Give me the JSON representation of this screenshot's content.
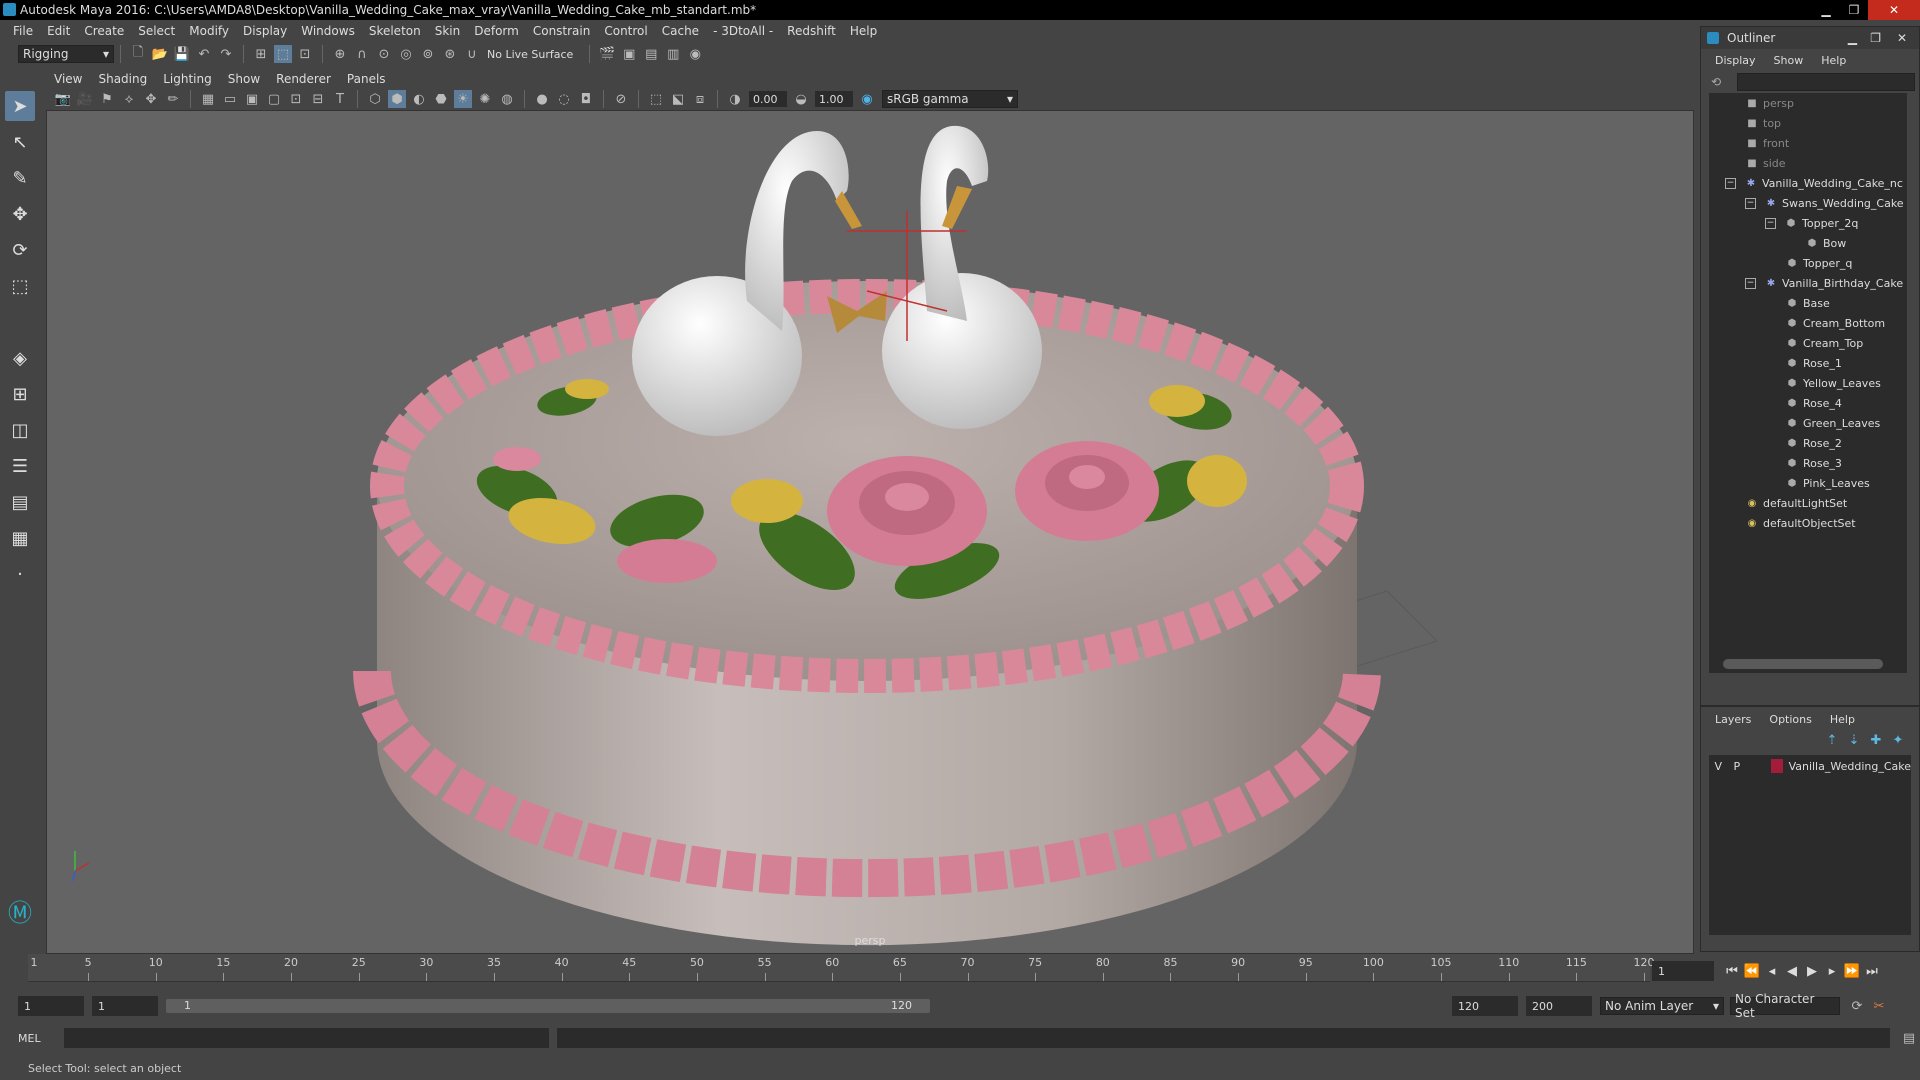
{
  "window": {
    "title": "Autodesk Maya 2016: C:\\Users\\AMDA8\\Desktop\\Vanilla_Wedding_Cake_max_vray\\Vanilla_Wedding_Cake_mb_standart.mb*"
  },
  "menus": [
    "File",
    "Edit",
    "Create",
    "Select",
    "Modify",
    "Display",
    "Windows",
    "Skeleton",
    "Skin",
    "Deform",
    "Constrain",
    "Control",
    "Cache",
    "- 3DtoAll -",
    "Redshift",
    "Help"
  ],
  "shelf": {
    "mode": "Rigging",
    "live_surface": "No Live Surface"
  },
  "panel_menus": [
    "View",
    "Shading",
    "Lighting",
    "Show",
    "Renderer",
    "Panels"
  ],
  "viewport_tools": {
    "exposure": "0.00",
    "gamma": "1.00",
    "colorspace": "sRGB gamma"
  },
  "viewport": {
    "camera_label": "persp"
  },
  "outliner": {
    "title": "Outliner",
    "menus": [
      "Display",
      "Show",
      "Help"
    ],
    "items": [
      {
        "label": "persp",
        "dim": true
      },
      {
        "label": "top",
        "dim": true
      },
      {
        "label": "front",
        "dim": true
      },
      {
        "label": "side",
        "dim": true
      },
      {
        "label": "Vanilla_Wedding_Cake_nc"
      },
      {
        "label": "Swans_Wedding_Cake"
      },
      {
        "label": "Topper_2q"
      },
      {
        "label": "Bow"
      },
      {
        "label": "Topper_q"
      },
      {
        "label": "Vanilla_Birthday_Cake"
      },
      {
        "label": "Base"
      },
      {
        "label": "Cream_Bottom"
      },
      {
        "label": "Cream_Top"
      },
      {
        "label": "Rose_1"
      },
      {
        "label": "Yellow_Leaves"
      },
      {
        "label": "Rose_4"
      },
      {
        "label": "Green_Leaves"
      },
      {
        "label": "Rose_2"
      },
      {
        "label": "Rose_3"
      },
      {
        "label": "Pink_Leaves"
      },
      {
        "label": "defaultLightSet"
      },
      {
        "label": "defaultObjectSet"
      }
    ]
  },
  "layers": {
    "menus": [
      "Layers",
      "Options",
      "Help"
    ],
    "row": {
      "v": "V",
      "p": "P",
      "name": "Vanilla_Wedding_Cake",
      "color": "#a31c3a"
    }
  },
  "timeline": {
    "ticks": [
      "5",
      "10",
      "15",
      "20",
      "25",
      "30",
      "35",
      "40",
      "45",
      "50",
      "55",
      "60",
      "65",
      "70",
      "75",
      "80",
      "85",
      "90",
      "95",
      "100",
      "105",
      "110",
      "115",
      "120"
    ],
    "start_marker": "1",
    "current_frame": "1"
  },
  "range": {
    "start": "1",
    "playback_start": "1",
    "slider_start": "1",
    "slider_end": "120",
    "playback_end": "120",
    "end": "200",
    "anim_layer": "No Anim Layer",
    "char_set": "No Character Set"
  },
  "command": {
    "label": "MEL"
  },
  "help_line": "Select Tool: select an object"
}
